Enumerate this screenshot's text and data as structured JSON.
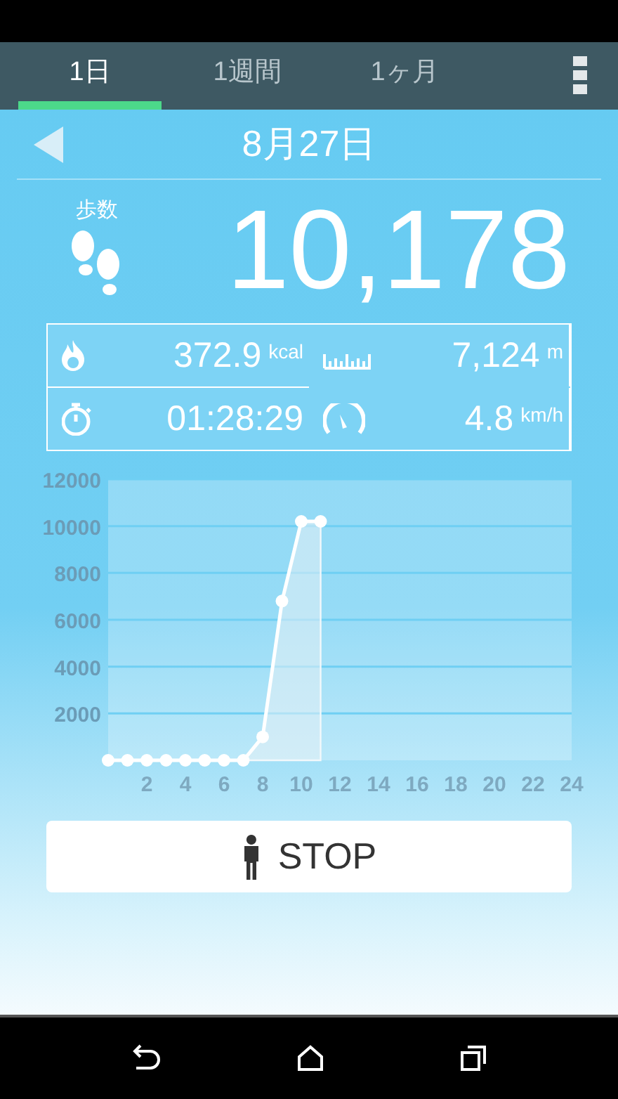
{
  "tabs": [
    {
      "label": "1日",
      "selected": true
    },
    {
      "label": "1週間",
      "selected": false
    },
    {
      "label": "1ヶ月",
      "selected": false
    }
  ],
  "date": "8月27日",
  "steps": {
    "label": "歩数",
    "value": "10,178"
  },
  "stats": [
    {
      "kind": "calories",
      "value": "372.9",
      "unit": "kcal"
    },
    {
      "kind": "distance",
      "value": "7,124",
      "unit": "m"
    },
    {
      "kind": "time",
      "value": "01:28:29"
    },
    {
      "kind": "speed",
      "value": "4.8",
      "unit": "km/h"
    }
  ],
  "chart": {
    "chart_data": {
      "type": "area",
      "x": [
        0,
        1,
        2,
        3,
        4,
        5,
        6,
        7,
        8,
        9,
        10,
        11
      ],
      "grid": true,
      "series": [
        {
          "color": "#ffffff",
          "values": [
            0,
            0,
            0,
            0,
            0,
            0,
            0,
            0,
            1000,
            6800,
            10200,
            10200
          ]
        }
      ],
      "xlim": [
        0,
        24
      ],
      "ylim": [
        0,
        12000
      ],
      "xticks": [
        2,
        4,
        6,
        8,
        10,
        12,
        14,
        16,
        18,
        20,
        22,
        24
      ],
      "yticks": [
        2000,
        4000,
        6000,
        8000,
        10000,
        12000
      ]
    }
  },
  "stop_button": {
    "label": "STOP"
  }
}
